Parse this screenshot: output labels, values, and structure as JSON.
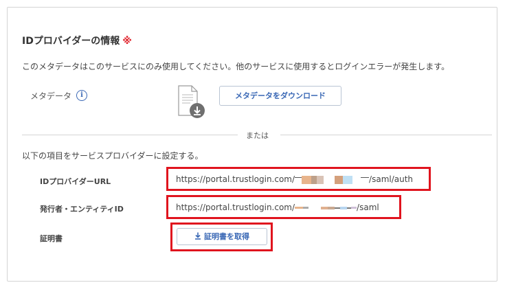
{
  "section": {
    "title": "IDプロバイダーの情報",
    "required_mark": "※",
    "description": "このメタデータはこのサービスにのみ使用してください。他のサービスに使用するとログインエラーが発生します。"
  },
  "metadata": {
    "label": "メタデータ",
    "info_icon": "i",
    "file_icon": "document-download-icon",
    "download_button": "メタデータをダウンロード"
  },
  "separator": {
    "text": "または"
  },
  "manual": {
    "instruction": "以下の項目をサービスプロバイダーに設定する。",
    "idp_url_label": "IDプロバイダーURL",
    "idp_url_prefix": "https://portal.trustlogin.com/",
    "idp_url_suffix": "/saml/auth",
    "issuer_label": "発行者・エンティティID",
    "issuer_prefix": "https://portal.trustlogin.com/",
    "issuer_suffix": "/saml",
    "cert_label": "証明書",
    "cert_button": "証明書を取得"
  },
  "colors": {
    "accent": "#3a68b5",
    "required": "#e0232c",
    "highlight": "#e0141e"
  }
}
